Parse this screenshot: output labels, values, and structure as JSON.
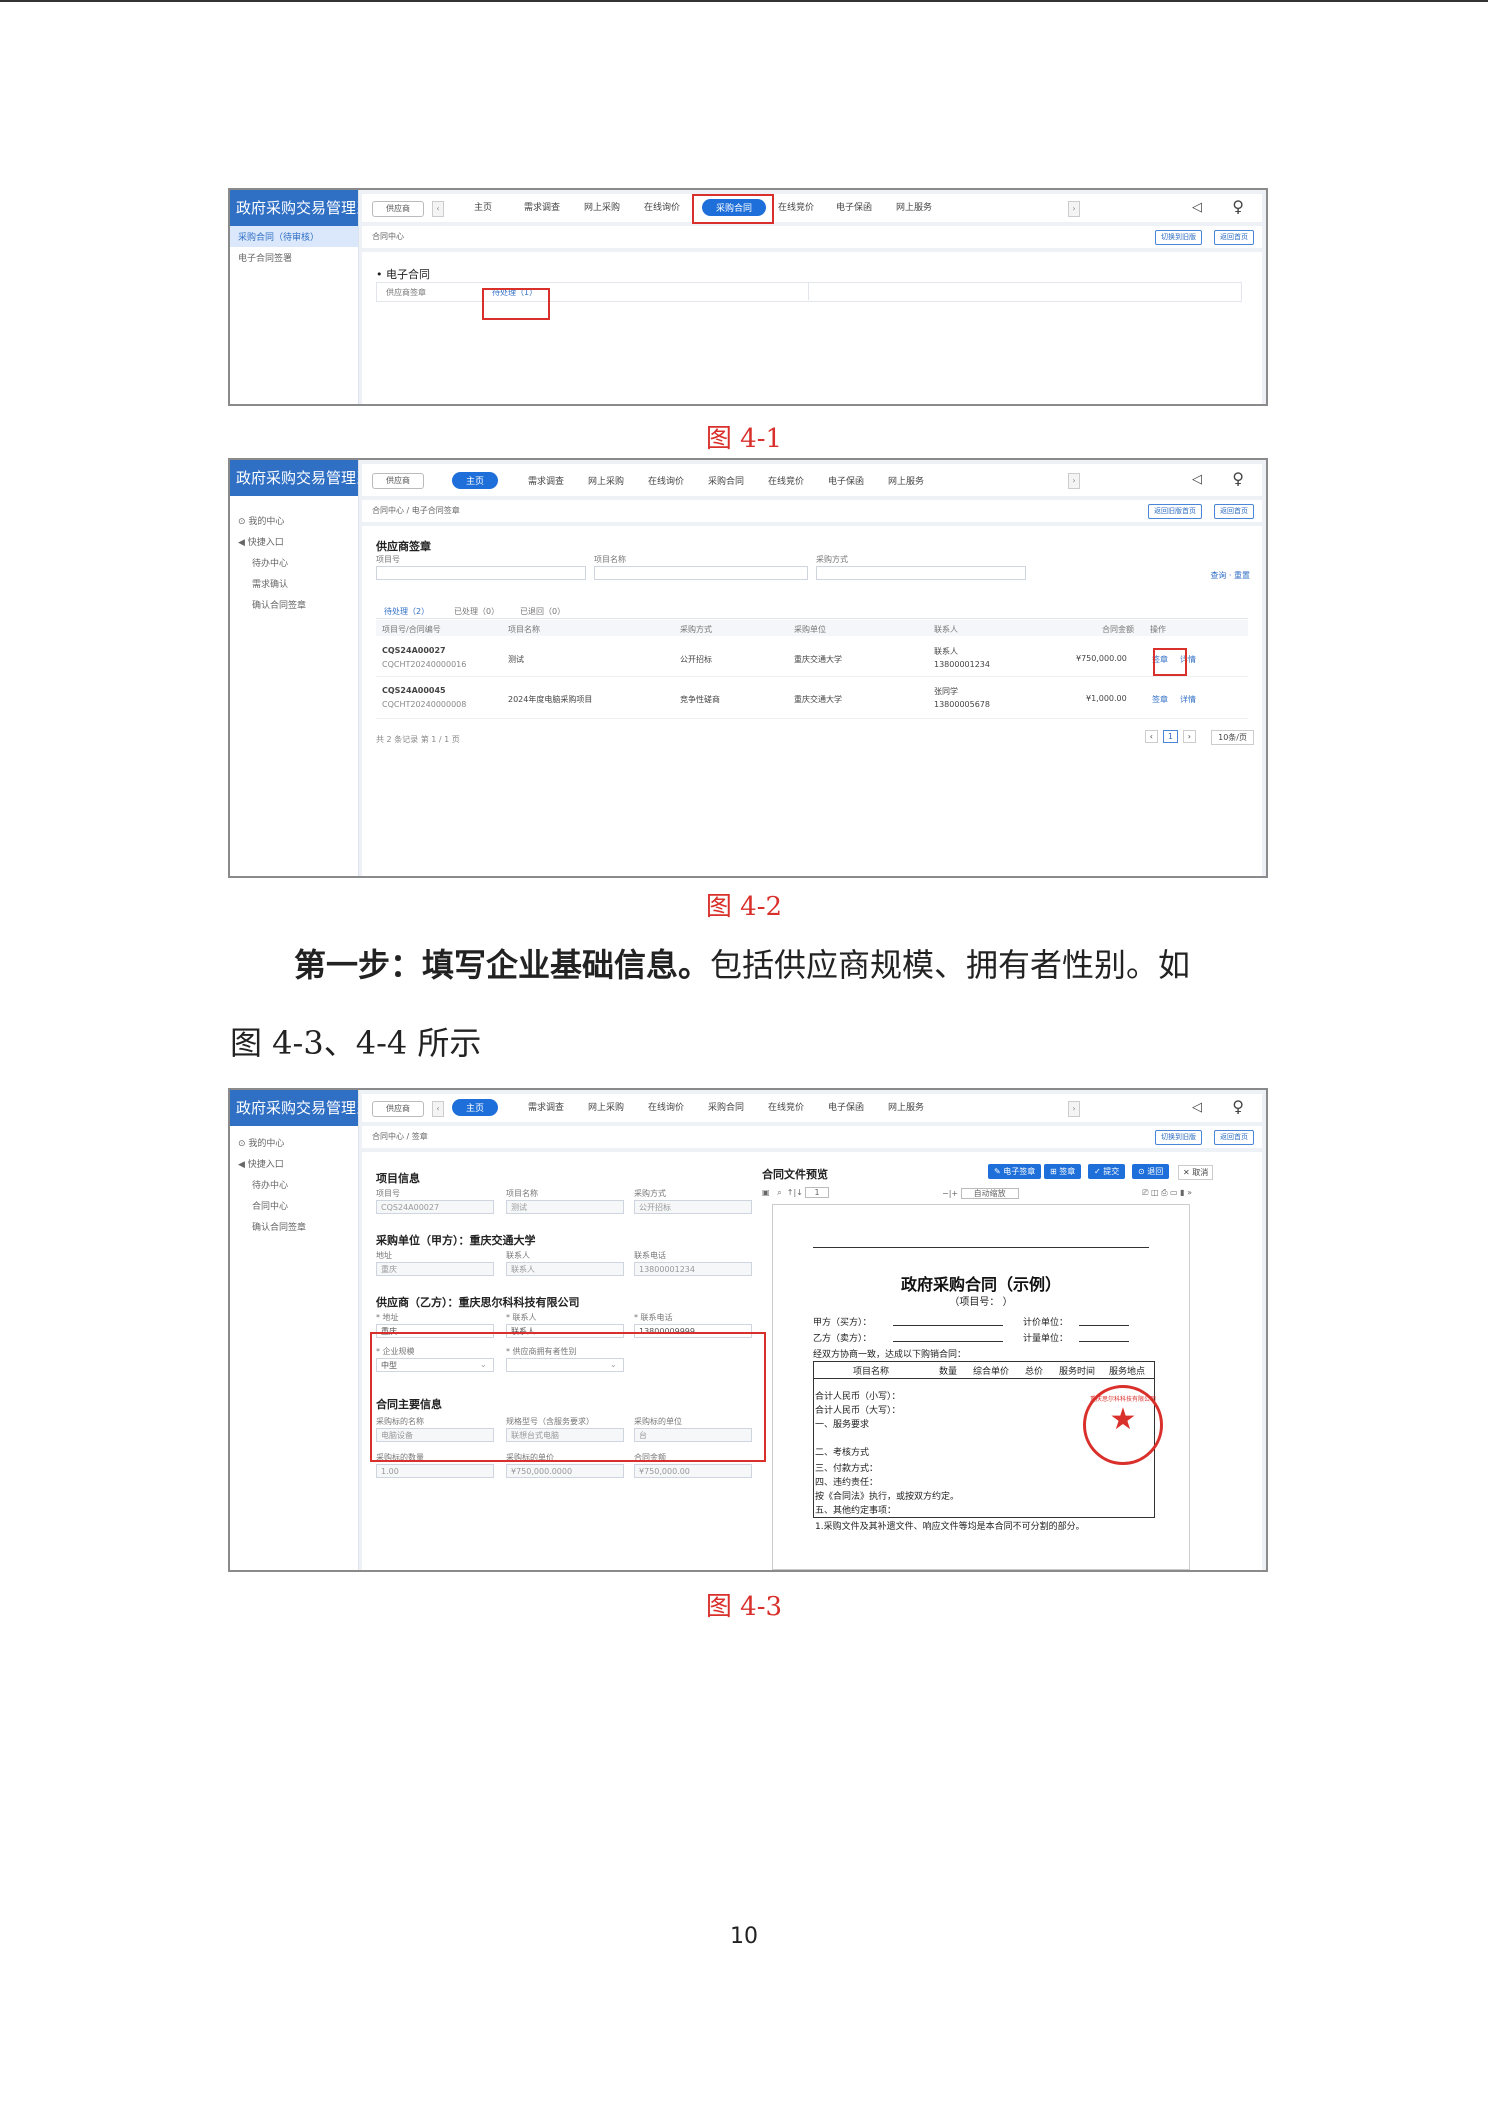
{
  "system_title": "政府采购交易管理系统",
  "fig1": {
    "sidebar": [
      "采购合同（待审核）",
      "电子合同签署"
    ],
    "role": "供应商",
    "nav": [
      "主页",
      "需求调查",
      "网上采购",
      "在线询价",
      "采购合同",
      "在线竞价",
      "电子保函",
      "网上服务"
    ],
    "active_nav": "采购合同",
    "crumb": "合同中心",
    "buttons": [
      "切换到旧版",
      "返回首页"
    ],
    "section_title": "• 电子合同",
    "row_label": "供应商签章",
    "row_value": "待处理（1）"
  },
  "caption1": "图 4-1",
  "fig2": {
    "sidebar": [
      "⊙ 我的中心",
      "◀ 快捷入口",
      "待办中心",
      "需求确认",
      "确认合同签章"
    ],
    "role": "供应商",
    "nav": [
      "主页",
      "需求调查",
      "网上采购",
      "在线询价",
      "采购合同",
      "在线竞价",
      "电子保函",
      "网上服务"
    ],
    "crumb": "合同中心 / 电子合同签章",
    "buttons": [
      "返回旧版首页",
      "返回首页"
    ],
    "title": "供应商签章",
    "filters": [
      "项目号",
      "项目名称",
      "采购方式"
    ],
    "search": "查询 · 重置",
    "tabs": [
      "待处理（2）",
      "已处理（0）",
      "已退回（0）"
    ],
    "headers": [
      "项目号/合同编号",
      "项目名称",
      "采购方式",
      "采购单位",
      "联系人",
      "合同金额",
      "操作"
    ],
    "rows": [
      {
        "code": "CQS24A00027",
        "sub": "CQCHT20240000016",
        "name": "测试",
        "method": "公开招标",
        "unit": "重庆交通大学",
        "contact": "联系人",
        "phone": "13800001234",
        "amount": "¥750,000.00",
        "op1": "签章",
        "op2": "详情"
      },
      {
        "code": "CQS24A00045",
        "sub": "CQCHT20240000008",
        "name": "2024年度电脑采购项目",
        "method": "竞争性磋商",
        "unit": "重庆交通大学",
        "contact": "张同学",
        "phone": "13800005678",
        "amount": "¥1,000.00",
        "op1": "签章",
        "op2": "详情"
      }
    ],
    "footer": "共 2 条记录 第 1 / 1 页",
    "page": "1",
    "page_size": "10条/页"
  },
  "caption2": "图 4-2",
  "para": {
    "bold": "第一步：填写企业基础信息。",
    "rest": "包括供应商规模、拥有者性别。如",
    "line2": "图 4-3、4-4 所示"
  },
  "fig3": {
    "sidebar": [
      "⊙ 我的中心",
      "◀ 快捷入口",
      "待办中心",
      "合同中心",
      "确认合同签章"
    ],
    "role": "供应商",
    "nav": [
      "主页",
      "需求调查",
      "网上采购",
      "在线询价",
      "采购合同",
      "在线竞价",
      "电子保函",
      "网上服务"
    ],
    "crumb": "合同中心 / 签章",
    "buttons": [
      "切换到旧版",
      "返回首页"
    ],
    "project_title": "项目信息",
    "project_labels": [
      "项目号",
      "项目名称",
      "采购方式"
    ],
    "project_values": [
      "CQS24A00027",
      "测试",
      "公开招标"
    ],
    "buyer_title": "采购单位（甲方）：重庆交通大学",
    "buyer_labels": [
      "地址",
      "联系人",
      "联系电话"
    ],
    "buyer_values": [
      "重庆",
      "联系人",
      "13800001234"
    ],
    "supplier_title": "供应商（乙方）：重庆思尔科科技有限公司",
    "supplier_labels": [
      "* 地址",
      "* 联系人",
      "* 联系电话"
    ],
    "supplier_values": [
      "重庆",
      "联系人",
      "13800009999"
    ],
    "supplier_labels2": [
      "* 企业规模",
      "* 供应商拥有者性别"
    ],
    "supplier_values2": [
      "中型",
      ""
    ],
    "contract_title": "合同主要信息",
    "contract_labels": [
      "采购标的名称",
      "规格型号（含服务要求）",
      "采购标的单位"
    ],
    "contract_values": [
      "电脑设备",
      "联想台式电脑",
      "台"
    ],
    "contract_labels2": [
      "采购标的数量",
      "采购标的单价",
      "合同金额"
    ],
    "contract_values2": [
      "1.00",
      "¥750,000.0000",
      "¥750,000.00"
    ],
    "preview_title": "合同文件预览",
    "preview_buttons": [
      "✎ 电子签章",
      "⊞ 签章",
      "✓ 提交",
      "⊙ 退回"
    ],
    "preview_cancel": "✕ 取消",
    "page_box": "1",
    "zoom": "自动缩放",
    "doc_title": "政府采购合同（示例）",
    "doc_sub": "（项目号：          ）",
    "doc_lines": [
      "甲方（买方）：",
      "乙方（卖方）：",
      "经双方协商一致，达成以下购销合同：",
      "合计人民币（小写）：",
      "合计人民币（大写）：",
      "一、服务要求",
      "二、考核方式",
      "三、付款方式：",
      "四、违约责任：",
      "按《合同法》执行，或按双方约定。",
      "五、其他约定事项：",
      "1.采购文件及其补遗文件、响应文件等均是本合同不可分割的部分。"
    ],
    "doc_right": [
      "计价单位：",
      "计量单位："
    ],
    "doc_headers": [
      "项目名称",
      "数量",
      "综合单价",
      "总价",
      "服务时间",
      "服务地点"
    ],
    "seal_text": "重庆思尔科科技有限公司"
  },
  "caption3": "图 4-3",
  "page_number": "10"
}
